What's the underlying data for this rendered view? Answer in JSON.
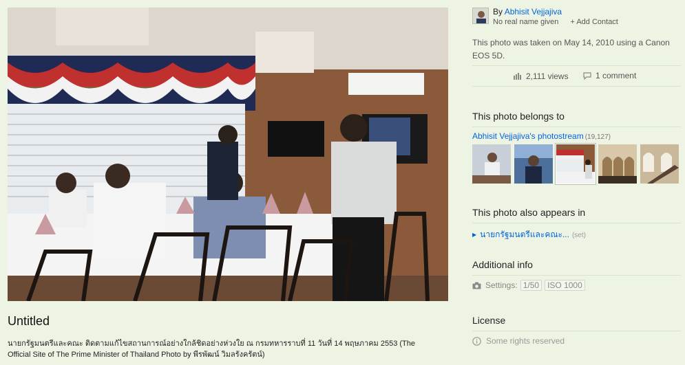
{
  "photo": {
    "title": "Untitled",
    "description": "นายกรัฐมนตรีและคณะ ติดตามแก้ไขสถานการณ์อย่างใกล้ชิดอย่างห่วงใย ณ กรมทหารราบที่ 11 วันที่ 14 พฤษภาคม 2553 (The Official Site of The Prime Minister of Thailand Photo by พีรพัฒน์ วิมลรังครัตน์)"
  },
  "owner": {
    "by_prefix": "By",
    "name": "Abhisit Vejjajiva",
    "real_name": "No real name given",
    "add_contact": "+ Add Contact"
  },
  "taken": "This photo was taken on May 14, 2010 using a Canon EOS 5D.",
  "stats": {
    "views": "2,111 views",
    "comments": "1 comment"
  },
  "belongs": {
    "heading": "This photo belongs to",
    "stream": "Abhisit Vejjajiva's photostream",
    "count": "(19,127)"
  },
  "appears": {
    "heading": "This photo also appears in",
    "set_name": "นายกรัฐมนตรีและคณะ...",
    "set_tag": "(set)"
  },
  "info": {
    "heading": "Additional info",
    "settings_label": "Settings:",
    "shutter": "1/50",
    "iso": "ISO 1000"
  },
  "license": {
    "heading": "License",
    "text": "Some rights reserved"
  },
  "icons": [
    "camera-icon",
    "views-icon",
    "comment-icon",
    "info-icon",
    "triangle-right-icon"
  ]
}
